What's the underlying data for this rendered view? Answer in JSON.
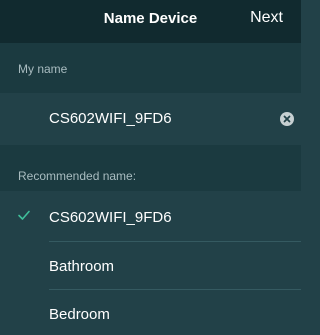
{
  "nav": {
    "title": "Name Device",
    "next_label": "Next"
  },
  "my_name": {
    "header": "My name",
    "value": "CS602WIFI_9FD6",
    "clear_icon": "clear-icon"
  },
  "recommended": {
    "header": "Recommended name:",
    "items": [
      {
        "label": "CS602WIFI_9FD6",
        "selected": true
      },
      {
        "label": "Bathroom",
        "selected": false
      },
      {
        "label": "Bedroom",
        "selected": false
      }
    ]
  },
  "colors": {
    "accent_check": "#3fbf9a",
    "background": "#224148",
    "nav_background": "#112a2f"
  }
}
